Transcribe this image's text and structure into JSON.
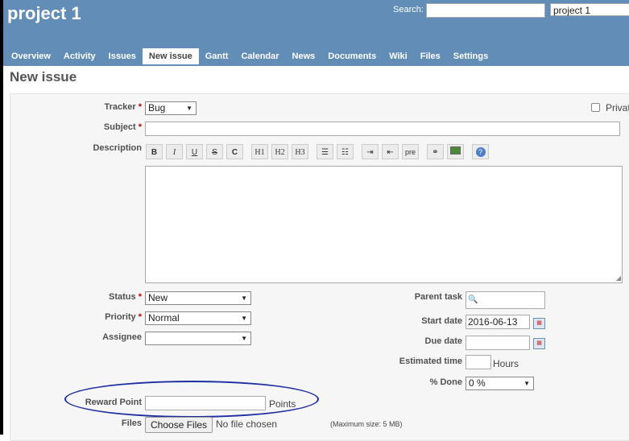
{
  "header": {
    "project_title": "project 1",
    "search_label": "Search:",
    "search_value": "",
    "project_jump": "project 1"
  },
  "tabs": [
    {
      "label": "Overview",
      "selected": false
    },
    {
      "label": "Activity",
      "selected": false
    },
    {
      "label": "Issues",
      "selected": false
    },
    {
      "label": "New issue",
      "selected": true
    },
    {
      "label": "Gantt",
      "selected": false
    },
    {
      "label": "Calendar",
      "selected": false
    },
    {
      "label": "News",
      "selected": false
    },
    {
      "label": "Documents",
      "selected": false
    },
    {
      "label": "Wiki",
      "selected": false
    },
    {
      "label": "Files",
      "selected": false
    },
    {
      "label": "Settings",
      "selected": false
    }
  ],
  "page_title": "New issue",
  "form": {
    "tracker_label": "Tracker",
    "tracker_value": "Bug",
    "private_label": "Privat",
    "subject_label": "Subject",
    "subject_value": "",
    "description_label": "Description",
    "toolbar": [
      "B",
      "I",
      "U",
      "S",
      "C",
      "H1",
      "H2",
      "H3",
      "ul",
      "ol",
      "indent-right",
      "indent-left",
      "pre",
      "link",
      "image",
      "help"
    ],
    "status_label": "Status",
    "status_value": "New",
    "priority_label": "Priority",
    "priority_value": "Normal",
    "assignee_label": "Assignee",
    "assignee_value": "",
    "parent_task_label": "Parent task",
    "start_date_label": "Start date",
    "start_date_value": "2016-06-13",
    "due_date_label": "Due date",
    "due_date_value": "",
    "estimated_time_label": "Estimated time",
    "estimated_time_value": "",
    "hours_label": "Hours",
    "done_label": "% Done",
    "done_value": "0 %",
    "reward_point_label": "Reward Point",
    "reward_point_value": "",
    "points_label": "Points",
    "files_label": "Files",
    "choose_files_label": "Choose Files",
    "no_file_label": "No file chosen",
    "max_size_label": "(Maximum size: 5 MB)"
  },
  "colors": {
    "header": "#628db6",
    "annotation": "#1c2ea0",
    "required": "#bb0000"
  }
}
